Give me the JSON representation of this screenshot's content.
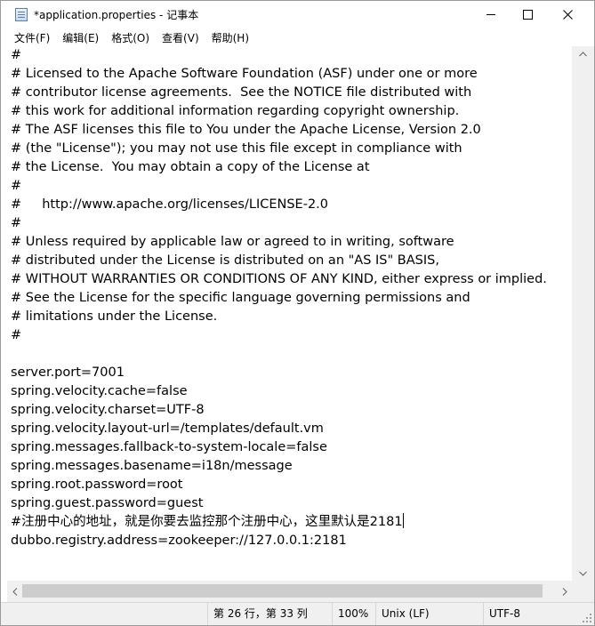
{
  "window": {
    "title": "*application.properties - 记事本"
  },
  "menu": [
    {
      "label": "文件(F)"
    },
    {
      "label": "编辑(E)"
    },
    {
      "label": "格式(O)"
    },
    {
      "label": "查看(V)"
    },
    {
      "label": "帮助(H)"
    }
  ],
  "editor": {
    "lines": [
      "#",
      "# Licensed to the Apache Software Foundation (ASF) under one or more",
      "# contributor license agreements.  See the NOTICE file distributed with",
      "# this work for additional information regarding copyright ownership.",
      "# The ASF licenses this file to You under the Apache License, Version 2.0",
      "# (the \"License\"); you may not use this file except in compliance with",
      "# the License.  You may obtain a copy of the License at",
      "#",
      "#     http://www.apache.org/licenses/LICENSE-2.0",
      "#",
      "# Unless required by applicable law or agreed to in writing, software",
      "# distributed under the License is distributed on an \"AS IS\" BASIS,",
      "# WITHOUT WARRANTIES OR CONDITIONS OF ANY KIND, either express or implied.",
      "# See the License for the specific language governing permissions and",
      "# limitations under the License.",
      "#",
      "",
      "server.port=7001",
      "spring.velocity.cache=false",
      "spring.velocity.charset=UTF-8",
      "spring.velocity.layout-url=/templates/default.vm",
      "spring.messages.fallback-to-system-locale=false",
      "spring.messages.basename=i18n/message",
      "spring.root.password=root",
      "spring.guest.password=guest",
      "#注册中心的地址，就是你要去监控那个注册中心，这里默认是2181",
      "dubbo.registry.address=zookeeper://127.0.0.1:2181"
    ]
  },
  "status": {
    "position": "第 26 行，第 33 列",
    "zoom": "100%",
    "line_ending": "Unix (LF)",
    "encoding": "UTF-8"
  }
}
